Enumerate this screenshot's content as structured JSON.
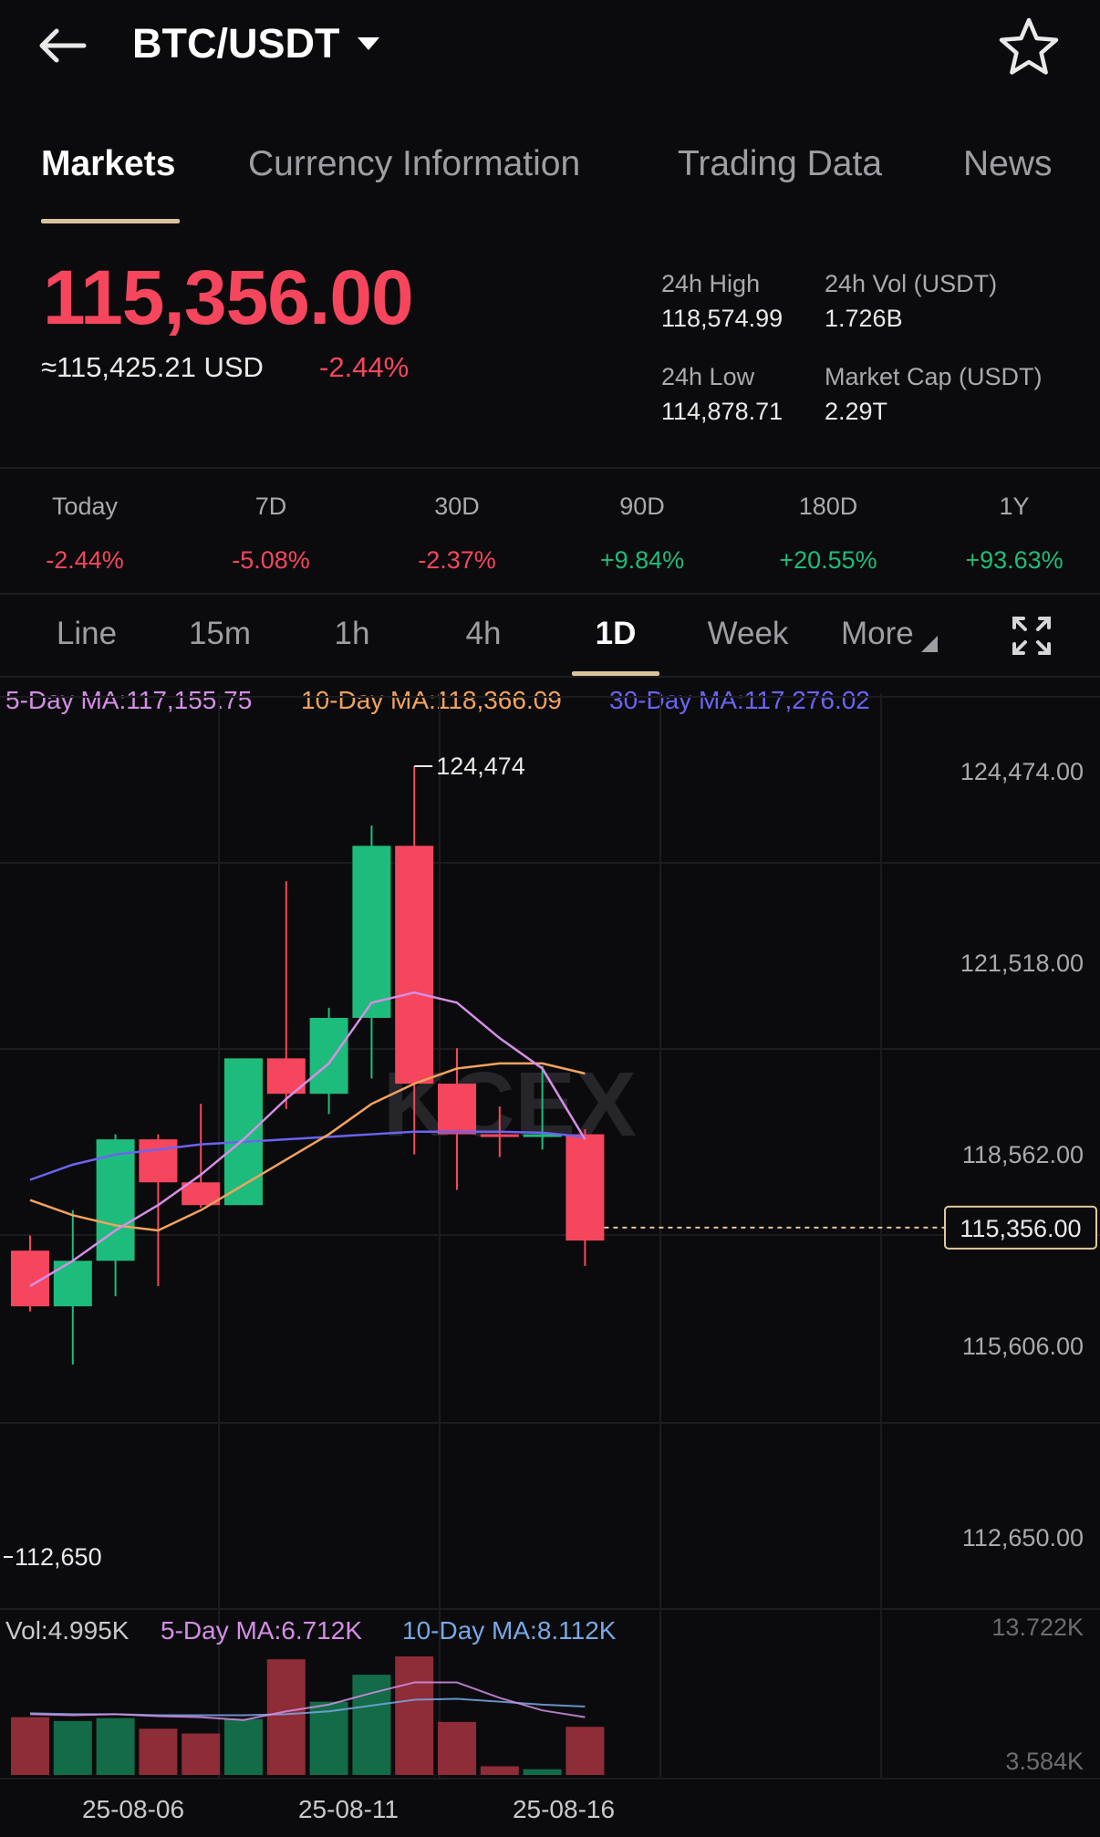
{
  "header": {
    "pair": "BTC/USDT",
    "back_icon": "arrow-left-icon",
    "favorite_icon": "star-outline-icon"
  },
  "tabs": [
    {
      "label": "Markets",
      "active": true
    },
    {
      "label": "Currency Information",
      "active": false
    },
    {
      "label": "Trading Data",
      "active": false
    },
    {
      "label": "News",
      "active": false
    }
  ],
  "ticker": {
    "price": "115,356.00",
    "usd_equiv": "≈115,425.21 USD",
    "change_pct": "-2.44%",
    "high_label": "24h High",
    "high_value": "118,574.99",
    "vol_label": "24h Vol  (USDT)",
    "vol_value": "1.726B",
    "low_label": "24h Low",
    "low_value": "114,878.71",
    "mcap_label": "Market Cap (USDT)",
    "mcap_value": "2.29T"
  },
  "periods": [
    {
      "label": "Today",
      "value": "-2.44%",
      "dir": "neg"
    },
    {
      "label": "7D",
      "value": "-5.08%",
      "dir": "neg"
    },
    {
      "label": "30D",
      "value": "-2.37%",
      "dir": "neg"
    },
    {
      "label": "90D",
      "value": "+9.84%",
      "dir": "pos"
    },
    {
      "label": "180D",
      "value": "+20.55%",
      "dir": "pos"
    },
    {
      "label": "1Y",
      "value": "+93.63%",
      "dir": "pos"
    }
  ],
  "intervals": [
    {
      "label": "Line",
      "active": false
    },
    {
      "label": "15m",
      "active": false
    },
    {
      "label": "1h",
      "active": false
    },
    {
      "label": "4h",
      "active": false
    },
    {
      "label": "1D",
      "active": true
    },
    {
      "label": "Week",
      "active": false
    },
    {
      "label": "More",
      "active": false
    }
  ],
  "fullscreen_icon": "expand-icon",
  "ma_legend": {
    "ma5": "5-Day MA:117,155.75",
    "ma10": "10-Day MA:118,366.09",
    "ma30": "30-Day MA:117,276.02"
  },
  "colors": {
    "up": "#1ebc7c",
    "down": "#f6465d",
    "ma5": "#d58ee6",
    "ma10": "#f2a35e",
    "ma30": "#6c63f2",
    "accent": "#d9c29c"
  },
  "chart_data": {
    "type": "candlestick",
    "watermark": "KCEX",
    "y_ticks": [
      "124,474.00",
      "121,518.00",
      "118,562.00",
      "115,606.00",
      "112,650.00"
    ],
    "ylim": [
      110000,
      125500
    ],
    "x_ticks": [
      "25-08-06",
      "25-08-11",
      "25-08-16"
    ],
    "last_price": 115356,
    "last_price_label": "115,356.00",
    "max_label": "124,474",
    "min_label": "112,650",
    "candles": [
      {
        "date": "25-08-02",
        "o": 114900,
        "h": 115200,
        "l": 113700,
        "c": 113800
      },
      {
        "date": "25-08-03",
        "o": 113800,
        "h": 115700,
        "l": 112650,
        "c": 114700
      },
      {
        "date": "25-08-04",
        "o": 114700,
        "h": 117200,
        "l": 114000,
        "c": 117100
      },
      {
        "date": "25-08-05",
        "o": 117100,
        "h": 117200,
        "l": 114200,
        "c": 116250
      },
      {
        "date": "25-08-06",
        "o": 116250,
        "h": 117800,
        "l": 115750,
        "c": 115800
      },
      {
        "date": "25-08-07",
        "o": 115800,
        "h": 118700,
        "l": 115800,
        "c": 118700
      },
      {
        "date": "25-08-08",
        "o": 118700,
        "h": 122200,
        "l": 117700,
        "c": 118000
      },
      {
        "date": "25-08-09",
        "o": 118000,
        "h": 119700,
        "l": 117600,
        "c": 119500
      },
      {
        "date": "25-08-10",
        "o": 119500,
        "h": 123300,
        "l": 118300,
        "c": 122900
      },
      {
        "date": "25-08-11",
        "o": 122900,
        "h": 124474,
        "l": 116800,
        "c": 118200
      },
      {
        "date": "25-08-12",
        "o": 118200,
        "h": 118900,
        "l": 116100,
        "c": 117200
      },
      {
        "date": "25-08-13",
        "o": 117200,
        "h": 117750,
        "l": 116750,
        "c": 117150
      },
      {
        "date": "25-08-14",
        "o": 117150,
        "h": 118550,
        "l": 116900,
        "c": 117200
      },
      {
        "date": "25-08-15",
        "o": 117200,
        "h": 117300,
        "l": 114600,
        "c": 115100
      }
    ],
    "ma5": [
      114200,
      114700,
      115300,
      115800,
      116400,
      117100,
      117900,
      118600,
      119800,
      120000,
      119800,
      119100,
      118500,
      117100
    ],
    "ma10": [
      115900,
      115600,
      115400,
      115300,
      115700,
      116200,
      116700,
      117200,
      117800,
      118200,
      118500,
      118600,
      118600,
      118400
    ],
    "ma30": [
      116300,
      116600,
      116800,
      116900,
      117000,
      117050,
      117100,
      117150,
      117200,
      117250,
      117250,
      117250,
      117230,
      117150
    ],
    "volume": {
      "legend_vol": "Vol:4.995K",
      "legend_ma5": "5-Day MA:6.712K",
      "legend_ma10": "10-Day MA:8.112K",
      "top_label": "13.722K",
      "bottom_label": "3.584K",
      "ylim": [
        0,
        13.722
      ],
      "values": [
        6.0,
        5.6,
        5.9,
        4.8,
        4.3,
        5.8,
        12.0,
        7.6,
        10.4,
        12.3,
        5.5,
        0.9,
        0.6,
        4.995
      ],
      "ma5": [
        6.3,
        6.2,
        6.3,
        6.1,
        6.0,
        5.7,
        6.6,
        7.3,
        8.5,
        9.6,
        9.6,
        8.0,
        6.7,
        6.0
      ],
      "ma10": [
        6.4,
        6.3,
        6.3,
        6.2,
        6.2,
        6.2,
        6.3,
        6.6,
        7.2,
        7.8,
        7.9,
        7.6,
        7.3,
        7.1
      ]
    }
  }
}
